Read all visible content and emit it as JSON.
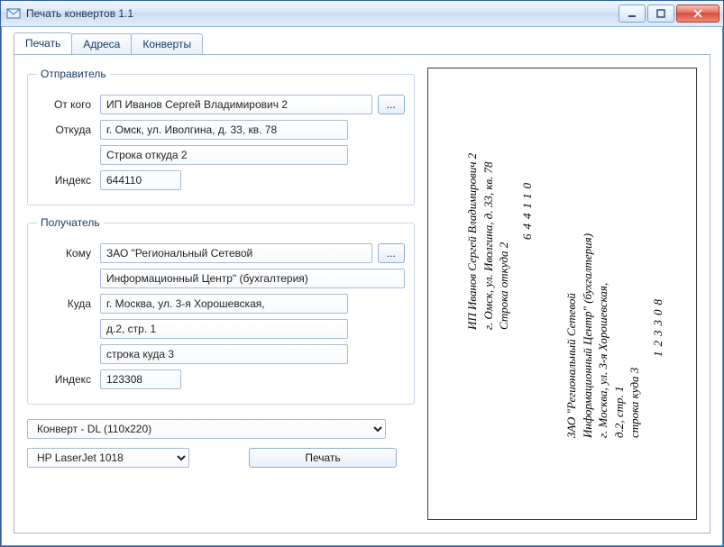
{
  "window": {
    "title": "Печать конвертов 1.1"
  },
  "tabs": {
    "print": "Печать",
    "addresses": "Адреса",
    "envelopes": "Конверты"
  },
  "sender": {
    "legend": "Отправитель",
    "from_label": "От кого",
    "from_value": "ИП Иванов Сергей Владимирович 2",
    "browse": "...",
    "addr_label": "Откуда",
    "addr_line1": "г. Омск, ул. Иволгина, д. 33, кв. 78",
    "addr_line2": "Строка откуда 2",
    "index_label": "Индекс",
    "index_value": "644110"
  },
  "recipient": {
    "legend": "Получатель",
    "to_label": "Кому",
    "to_line1": "ЗАО \"Региональный Сетевой",
    "to_line2": "Информационный Центр\" (бухгалтерия)",
    "browse": "...",
    "addr_label": "Куда",
    "addr_line1": "г. Москва, ул. 3-я Хорошевская,",
    "addr_line2": "д.2, стр. 1",
    "addr_line3": "строка куда 3",
    "index_label": "Индекс",
    "index_value": "123308"
  },
  "envelope_combo": "Конверт - DL (110x220)",
  "printer_combo": "HP LaserJet 1018",
  "print_button": "Печать",
  "preview": {
    "sender_lines": [
      "ИП Иванов Сергей Владимирович 2",
      "г. Омск, ул. Иволгина, д. 33, кв. 78",
      "Строка откуда 2"
    ],
    "sender_index": "644110",
    "recipient_lines": [
      "ЗАО \"Региональный Сетевой",
      "Информационный Центр\" (бухгалтерия)",
      "г. Москва, ул. 3-я Хорошевская,",
      "д.2, стр. 1",
      "строка куда 3"
    ],
    "recipient_index": "123308"
  }
}
